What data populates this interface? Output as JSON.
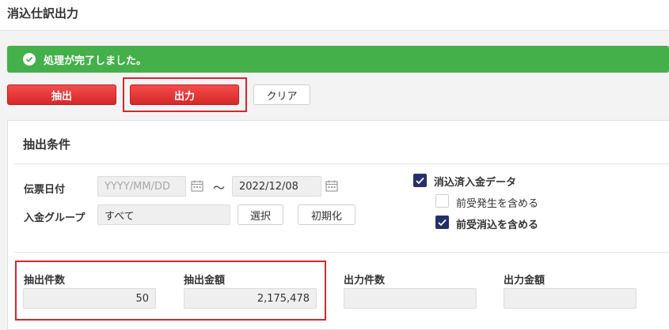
{
  "page": {
    "title": "消込仕訳出力"
  },
  "alert": {
    "message": "処理が完了しました。",
    "color": "#43b04a"
  },
  "toolbar": {
    "extract_label": "抽出",
    "output_label": "出力",
    "clear_label": "クリア"
  },
  "conditions": {
    "title": "抽出条件",
    "slip_date": {
      "label": "伝票日付",
      "from_placeholder": "YYYY/MM/DD",
      "separator": "～",
      "to_value": "2022/12/08"
    },
    "deposit_group": {
      "label": "入金グループ",
      "value": "すべて",
      "select_label": "選択",
      "reset_label": "初期化"
    },
    "checkboxes": [
      {
        "label": "消込済入金データ",
        "checked": true
      },
      {
        "label": "前受発生を含める",
        "checked": false
      },
      {
        "label": "前受消込を含める",
        "checked": true
      }
    ]
  },
  "results": {
    "extract_count": {
      "label": "抽出件数",
      "value": "50"
    },
    "extract_amount": {
      "label": "抽出金額",
      "value": "2,175,478"
    },
    "output_count": {
      "label": "出力件数",
      "value": ""
    },
    "output_amount": {
      "label": "出力金額",
      "value": ""
    }
  },
  "colors": {
    "primary_red": "#e53935",
    "highlight": "#d8262c",
    "check_navy": "#25306a"
  }
}
